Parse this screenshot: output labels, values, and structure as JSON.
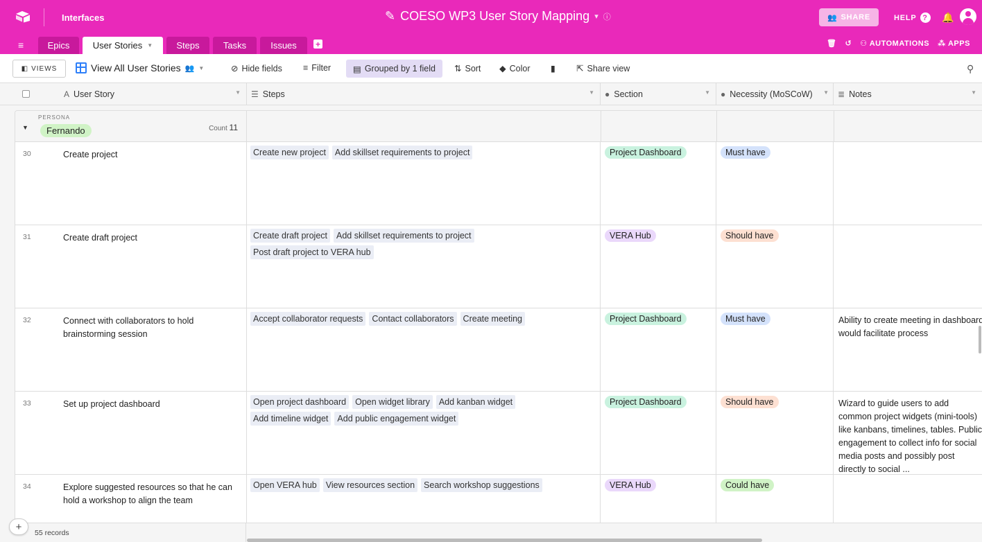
{
  "topbar": {
    "interfaces_label": "Interfaces",
    "base_title": "COESO WP3 User Story Mapping",
    "share_label": "SHARE",
    "help_label": "HELP",
    "brand_color": "#e929ba"
  },
  "tabs": [
    {
      "label": "Epics",
      "active": false
    },
    {
      "label": "User Stories",
      "active": true
    },
    {
      "label": "Steps",
      "active": false
    },
    {
      "label": "Tasks",
      "active": false
    },
    {
      "label": "Issues",
      "active": false
    }
  ],
  "tabbar": {
    "automations_label": "AUTOMATIONS",
    "apps_label": "APPS"
  },
  "toolbar": {
    "views_label": "VIEWS",
    "view_name": "View All User Stories",
    "hide_fields": "Hide fields",
    "filter": "Filter",
    "grouped": "Grouped by 1 field",
    "sort": "Sort",
    "color": "Color",
    "share_view": "Share view"
  },
  "columns": {
    "user_story": "User Story",
    "steps": "Steps",
    "section": "Section",
    "necessity": "Necessity (MoSCoW)",
    "notes": "Notes"
  },
  "group": {
    "field_label": "PERSONA",
    "value": "Fernando",
    "count_label": "Count",
    "count": "11"
  },
  "rows": [
    {
      "num": "30",
      "story": "Create project",
      "steps": [
        "Create new project",
        "Add skillset requirements to project"
      ],
      "section": "Project Dashboard",
      "necessity": "Must have",
      "notes": ""
    },
    {
      "num": "31",
      "story": "Create draft project",
      "steps": [
        "Create draft project",
        "Add skillset requirements to project",
        "Post draft project to VERA hub"
      ],
      "section": "VERA Hub",
      "necessity": "Should have",
      "notes": ""
    },
    {
      "num": "32",
      "story": "Connect with collaborators to hold brainstorming session",
      "steps": [
        "Accept collaborator requests",
        "Contact collaborators",
        "Create meeting"
      ],
      "section": "Project Dashboard",
      "necessity": "Must have",
      "notes": "Ability to create meeting in dashboard would facilitate process"
    },
    {
      "num": "33",
      "story": "Set up project dashboard",
      "steps": [
        "Open project dashboard",
        "Open widget library",
        "Add kanban widget",
        "Add timeline widget",
        "Add public engagement widget"
      ],
      "section": "Project Dashboard",
      "necessity": "Should have",
      "notes": "Wizard to guide users to add common project widgets (mini-tools) like kanbans, timelines, tables. Public engagement to collect info for social media posts and possibly post directly to social ..."
    },
    {
      "num": "34",
      "story": "Explore suggested resources so that he can hold a workshop to align the team",
      "steps": [
        "Open VERA hub",
        "View resources section",
        "Search workshop suggestions"
      ],
      "section": "VERA Hub",
      "necessity": "Could have",
      "notes": ""
    }
  ],
  "section_colors": {
    "Project Dashboard": "#c9f2df",
    "VERA Hub": "#ead8fb"
  },
  "necessity_colors": {
    "Must have": "#d4e2fb",
    "Should have": "#fde0d2",
    "Could have": "#d0f3c6"
  },
  "footer": {
    "records": "55 records"
  }
}
